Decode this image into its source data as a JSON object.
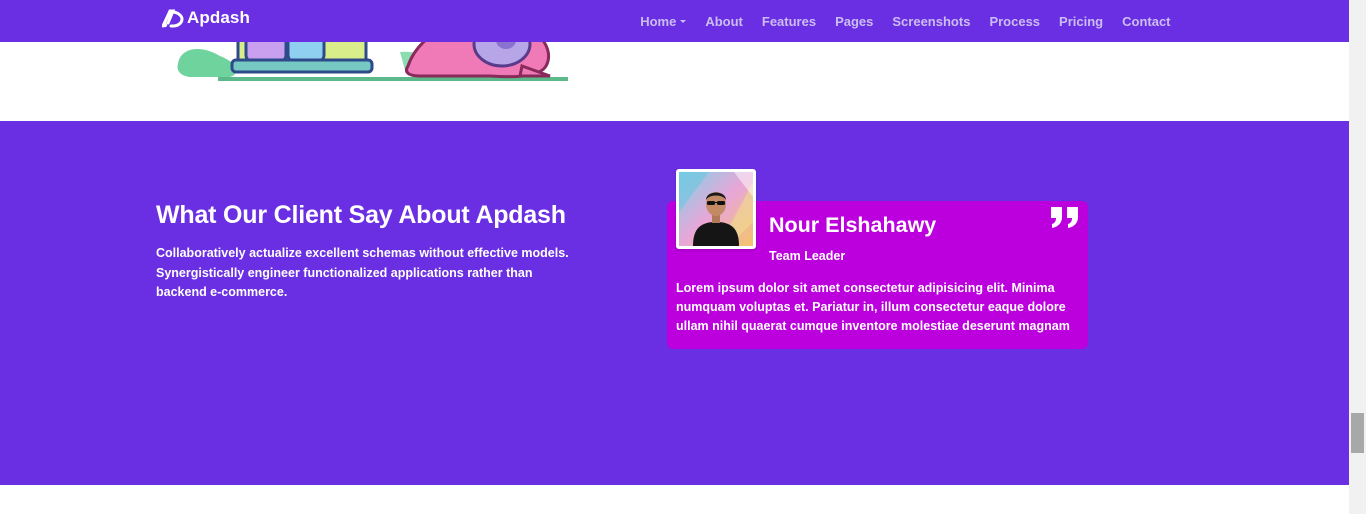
{
  "navbar": {
    "brand": "Apdash",
    "brand_icon": "apdash-logo-icon",
    "links": [
      {
        "label": "Home",
        "has_dropdown": true
      },
      {
        "label": "About"
      },
      {
        "label": "Features"
      },
      {
        "label": "Pages"
      },
      {
        "label": "Screenshots"
      },
      {
        "label": "Process"
      },
      {
        "label": "Pricing"
      },
      {
        "label": "Contact"
      }
    ]
  },
  "testimonial": {
    "title": "What Our Client Say About Apdash",
    "description": "Collaboratively actualize excellent schemas without effective models. Synergistically engineer functionalized applications rather than backend e-commerce.",
    "client": {
      "name": "Nour Elshahawy",
      "role": "Team Leader",
      "quote": "Lorem ipsum dolor sit amet consectetur adipisicing elit. Minima numquam voluptas et. Pariatur in, illum consectetur eaque dolore ullam nihil quaerat cumque inventore molestiae deserunt magnam"
    },
    "quote_icon": "quote-mark-icon"
  },
  "colors": {
    "primary": "#6a2fe2",
    "card": "#bb00dd",
    "nav_link": "#cbbdf3",
    "white": "#ffffff"
  }
}
